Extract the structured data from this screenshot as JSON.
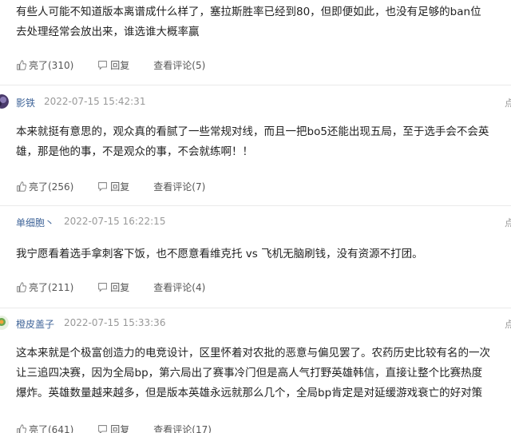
{
  "comments": [
    {
      "text": "有些人可能不知道版本离谱成什么样了，塞拉斯胜率已经到80，但即便如此，也没有足够的ban位去处理经常会放出来，谁选谁大概率赢",
      "like_label": "亮了(310)",
      "reply_label": "回复",
      "view_label": "查看评论(5)"
    },
    {
      "username": "影铁",
      "timestamp": "2022-07-15 15:42:31",
      "report": "点",
      "text": "本来就挺有意思的，观众真的看腻了一些常规对线，而且一把bo5还能出现五局，至于选手会不会英雄，那是他的事，不是观众的事，不会就练啊！！",
      "like_label": "亮了(256)",
      "reply_label": "回复",
      "view_label": "查看评论(7)"
    },
    {
      "username": "单细胞丶",
      "timestamp": "2022-07-15 16:22:15",
      "report": "点",
      "text": "我宁愿看着选手拿刺客下饭，也不愿意看维克托 vs 飞机无脑刷钱，没有资源不打团。",
      "like_label": "亮了(211)",
      "reply_label": "回复",
      "view_label": "查看评论(4)"
    },
    {
      "username": "橙皮盖子",
      "timestamp": "2022-07-15 15:33:36",
      "report": "点",
      "text": "这本来就是个极富创造力的电竞设计，区里怀着对农批的恶意与偏见罢了。农药历史比较有名的一次让三追四决赛，因为全局bp，第六局出了赛事冷门但是高人气打野英雄韩信，直接让整个比赛热度爆炸。英雄数量越来越多，但是版本英雄永远就那么几个，全局bp肯定是对延缓游戏衰亡的好对策",
      "like_label": "亮了(641)",
      "reply_label": "回复",
      "view_label": "查看评论(17)"
    }
  ]
}
